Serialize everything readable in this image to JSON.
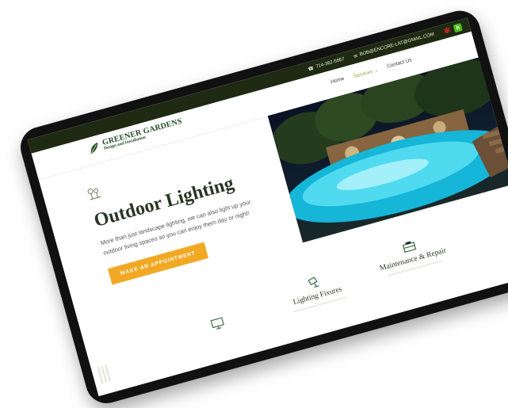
{
  "topbar": {
    "phone": "714-362-5867",
    "email": "BOB@ENCORE-LAT@GMAIL.COM",
    "social": {
      "yelp_icon": "yelp-icon",
      "houzz_icon": "houzz-icon"
    }
  },
  "logo": {
    "name": "GREENER GARDENS",
    "tagline": "Design and Installation"
  },
  "nav": {
    "items": [
      "Home",
      "Services",
      "Contact Us"
    ],
    "active": "Services",
    "services_caret": "⌄"
  },
  "hero": {
    "title": "Outdoor Lighting",
    "subtitle": "More than just landscape lighting, we can also light up your outdoor living spaces so you can enjoy them day or night!",
    "cta_label": "MAKE AN APPOINTMENT"
  },
  "services": [
    {
      "title": "",
      "icon": "monitor-icon"
    },
    {
      "title": "Lighting Fixures",
      "icon": "lamp-icon"
    },
    {
      "title": "Maintenance & Repair",
      "icon": "toolbox-icon"
    }
  ],
  "colors": {
    "topbar": "#1e2a12",
    "accent_green": "#8fb03b",
    "cta": "#f1a925",
    "logo_green": "#1d4b22"
  }
}
